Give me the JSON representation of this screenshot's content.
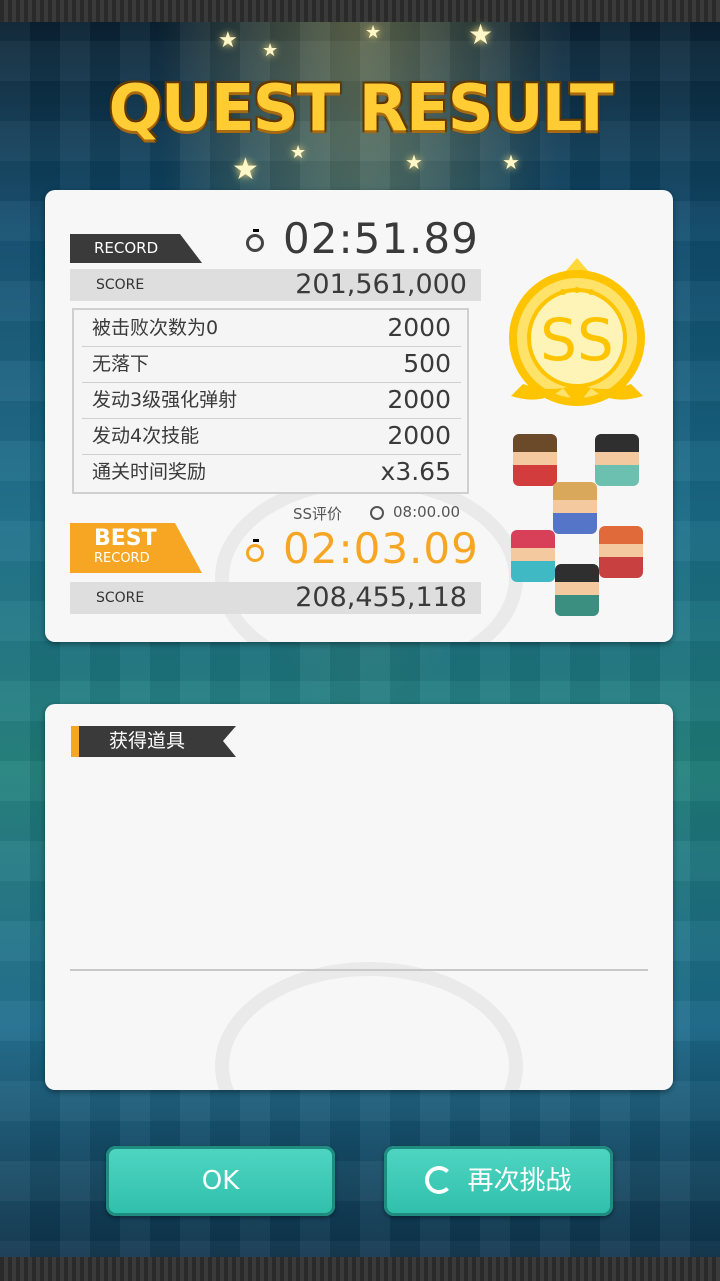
{
  "title": "QUEST RESULT",
  "record": {
    "tag": "RECORD",
    "time": "02:51.89",
    "score_label": "SCORE",
    "score": "201,561,000"
  },
  "bonuses": [
    {
      "label": "被击败次数为0",
      "value": "2000"
    },
    {
      "label": "无落下",
      "value": "500"
    },
    {
      "label": "发动3级强化弹射",
      "value": "2000"
    },
    {
      "label": "发动4次技能",
      "value": "2000"
    },
    {
      "label": "通关时间奖励",
      "value": "x3.65"
    }
  ],
  "ss_note": {
    "label": "SS评价",
    "time": "08:00.00"
  },
  "best": {
    "tag_big": "BEST",
    "tag_small": "RECORD",
    "time": "02:03.09",
    "score_label": "SCORE",
    "score": "208,455,118"
  },
  "rank": "SS",
  "items_section": {
    "label": "获得道具"
  },
  "buttons": {
    "ok": "OK",
    "retry": "再次挑战"
  },
  "colors": {
    "accent_orange": "#f6a623",
    "button_teal": "#35c4b0",
    "title_gold": "#ffcc33",
    "rank_gold": "#ffd83a"
  },
  "icons": [
    "stopwatch-icon",
    "retry-icon",
    "rank-ss-badge",
    "character-sprite"
  ]
}
